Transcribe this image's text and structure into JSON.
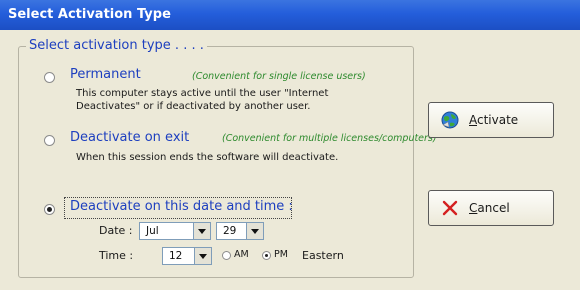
{
  "window": {
    "title": "Select Activation Type"
  },
  "group": {
    "legend": "Select activation type . . . ."
  },
  "options": {
    "permanent": {
      "label": "Permanent",
      "hint": "(Convenient for single license users)",
      "desc_line1": "This computer stays active until the user \"Internet",
      "desc_line2": "Deactivates\" or if deactivated by another user.",
      "selected": false
    },
    "exit": {
      "label": "Deactivate on exit",
      "hint": "(Convenient for multiple licenses/computers)",
      "desc": "When this session ends the software will deactivate.",
      "selected": false
    },
    "date": {
      "label": "Deactivate on this date and time :",
      "selected": true
    }
  },
  "schedule": {
    "date_label": "Date :",
    "month": "Jul",
    "day": "29",
    "time_label": "Time :",
    "hour": "12",
    "am_label": "AM",
    "pm_label": "PM",
    "ampm_selected": "PM",
    "timezone": "Eastern"
  },
  "buttons": {
    "activate": "Activate",
    "cancel": "Cancel"
  },
  "icons": {
    "activate": "globe-icon",
    "cancel": "red-x-icon"
  }
}
